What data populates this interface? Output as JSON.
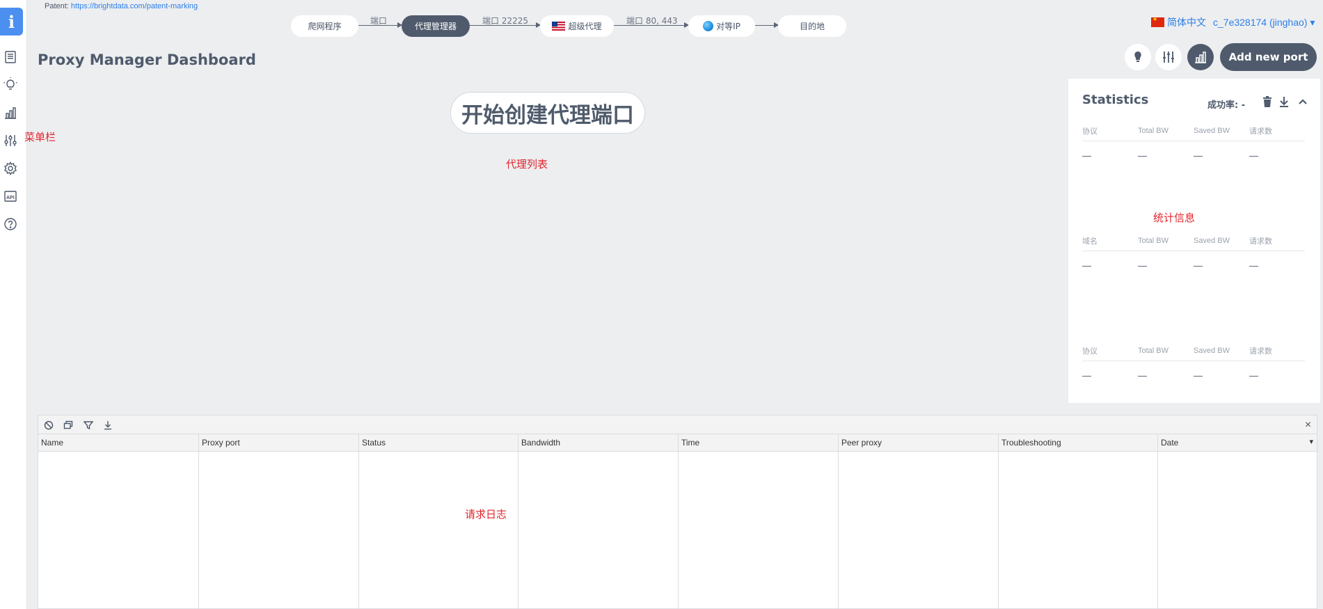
{
  "patent": {
    "label": "Patent:",
    "link": "https://brightdata.com/patent-marking"
  },
  "flow": {
    "nodes": [
      "爬网程序",
      "代理管理器",
      "超级代理",
      "对等IP",
      "目的地"
    ],
    "edge_labels": [
      "端口",
      "端口 22225",
      "端口 80, 443"
    ]
  },
  "header": {
    "language": "简体中文",
    "user": "c_7e328174 (jinghao) ▾"
  },
  "page_title": "Proxy Manager Dashboard",
  "toolbar": {
    "add_port_label": "Add new port"
  },
  "start_button": "开始创建代理端口",
  "annotations": {
    "menu_bar": "菜单栏",
    "proxy_list": "代理列表",
    "statistics": "统计信息",
    "request_log": "请求日志"
  },
  "statistics": {
    "title": "Statistics",
    "success_rate": "成功率: -",
    "tables": [
      {
        "headers": [
          "协议",
          "Total BW",
          "Saved BW",
          "请求数"
        ],
        "row": [
          "—",
          "—",
          "—",
          "—"
        ]
      },
      {
        "headers": [
          "域名",
          "Total BW",
          "Saved BW",
          "请求数"
        ],
        "row": [
          "—",
          "—",
          "—",
          "—"
        ]
      },
      {
        "headers": [
          "协议",
          "Total BW",
          "Saved BW",
          "请求数"
        ],
        "row": [
          "—",
          "—",
          "—",
          "—"
        ]
      }
    ]
  },
  "logs": {
    "columns": [
      "Name",
      "Proxy port",
      "Status",
      "Bandwidth",
      "Time",
      "Peer proxy",
      "Troubleshooting",
      "Date"
    ],
    "sort_indicator": "▾",
    "close": "×"
  },
  "sidebar": {
    "logo": "i",
    "icons": [
      "list-icon",
      "lightbulb-icon",
      "bar-chart-icon",
      "sliders-icon",
      "gear-icon",
      "api-icon",
      "help-icon"
    ]
  }
}
